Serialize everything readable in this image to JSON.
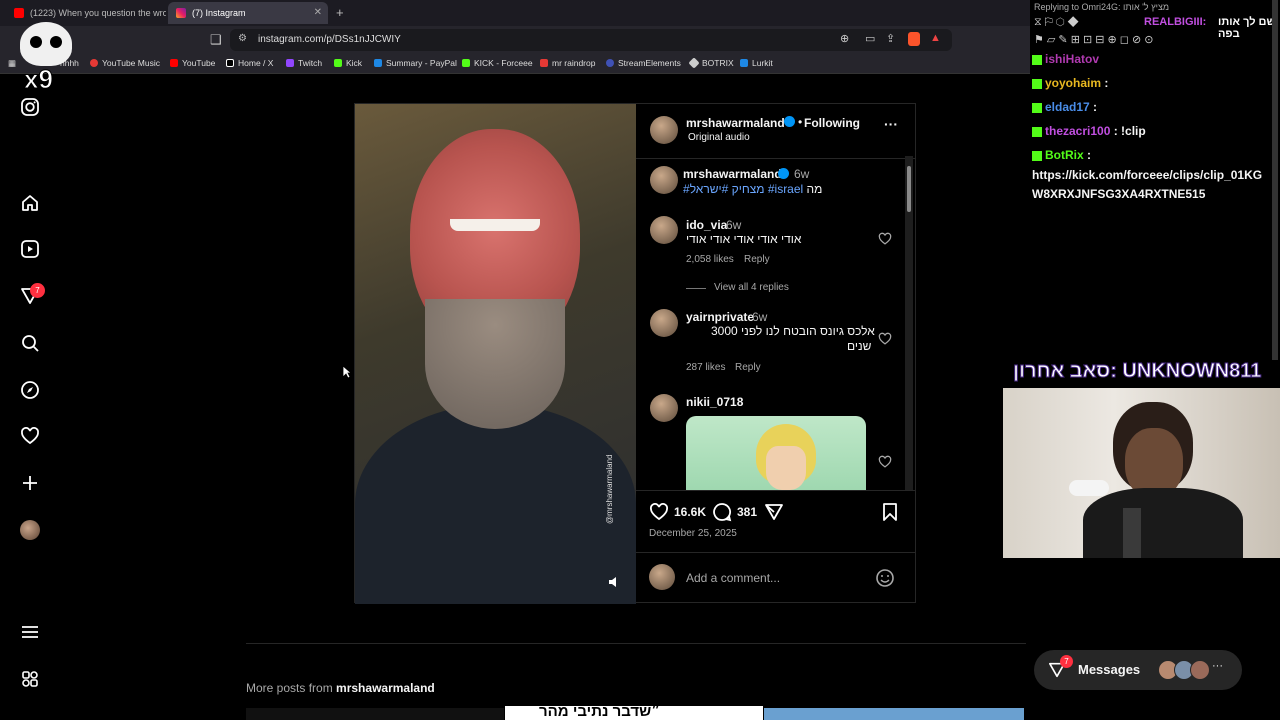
{
  "tabs": [
    {
      "title": "(1223) When you question the wrong",
      "active": false
    },
    {
      "title": "(7) Instagram",
      "active": true
    }
  ],
  "url": "instagram.com/p/DSs1nJJCWIY",
  "bookmarks": [
    "hhhh",
    "YouTube Music",
    "YouTube",
    "Home / X",
    "Twitch",
    "Kick",
    "Summary - PayPal",
    "KICK - Forceee",
    "mr raindrop",
    "StreamElements",
    "BOTRIX",
    "Lurkit"
  ],
  "overlay_badge": "x9",
  "nav": {
    "notif_count": "7"
  },
  "post": {
    "username": "mrshawarmaland",
    "following": "Following",
    "audio": "Original audio",
    "caption_user": "mrshawarmaland",
    "caption_age": "6w",
    "caption_text": "מה",
    "caption_tags": "#מצחיק #ישראל #israel",
    "watermark": "@mrshawarmaland",
    "comments": [
      {
        "user": "ido_via",
        "age": "6w",
        "text": "אודי אודי אודי אודי אודי",
        "likes": "2,058 likes",
        "reply": "Reply",
        "view_replies": "View all 4 replies"
      },
      {
        "user": "yairnprivate",
        "age": "6w",
        "text_line1": "אלכס גיונס הובטח לנו לפני 3000",
        "text_line2": "שנים",
        "likes": "287 likes",
        "reply": "Reply"
      },
      {
        "user": "nikii_0718"
      }
    ],
    "like_count": "16.6K",
    "comment_count": "381",
    "date": "December 25, 2025",
    "add_comment": "Add a comment..."
  },
  "more_posts": {
    "label": "More posts from",
    "user": "mrshawarmaland",
    "preview_text": "״שדבר נתיבי מהר"
  },
  "messages": {
    "label": "Messages",
    "count": "7"
  },
  "stream": {
    "reply_header": "Replying to Omri24G: מציץ ל' אותו",
    "top_line_user": "REALBIGIII:",
    "top_line_text": "שם לך אותו בפה",
    "chat": [
      {
        "user": "ishiHatov",
        "text": "",
        "color": "#b03ab0"
      },
      {
        "user": "yoyohaim",
        "text": ":",
        "color": "#e8b820"
      },
      {
        "user": "eldad17",
        "text": ":",
        "color": "#4a8de8"
      },
      {
        "user": "thezacri100",
        "text": ": !clip",
        "color": "#c14fe0"
      },
      {
        "user": "BotRix",
        "text": ":",
        "color": "#53fc18"
      }
    ],
    "link_line1": "https://kick.com/forceee/clips/clip_01KG",
    "link_line2": "W8XRXJNFSG3XA4RXTNE515",
    "last_sub": "סאב אחרון: UNKNOWN811"
  }
}
